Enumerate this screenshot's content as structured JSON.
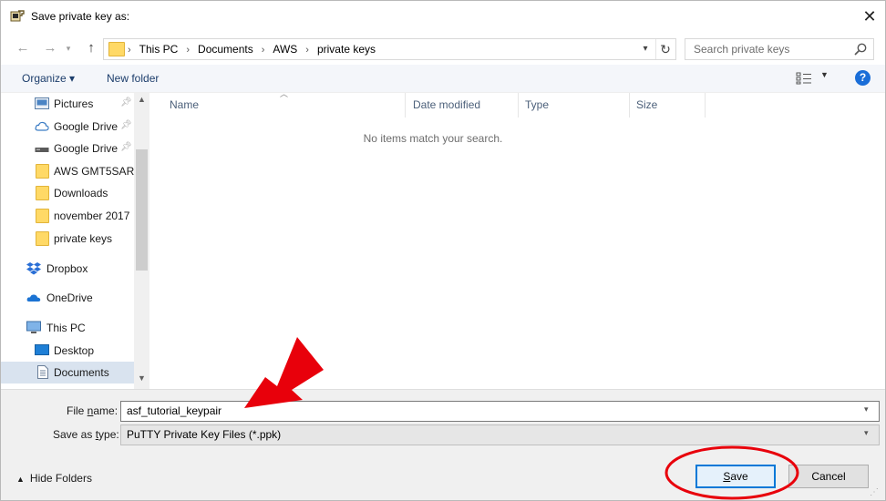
{
  "window": {
    "title": "Save private key as:",
    "close_glyph": "✕"
  },
  "nav": {
    "back_icon": "arrow-left-icon",
    "forward_icon": "arrow-right-icon",
    "recent_icon": "chevron-down-icon",
    "up_icon": "arrow-up-icon",
    "breadcrumb": [
      "This PC",
      "Documents",
      "AWS",
      "private keys"
    ],
    "search_placeholder": "Search private keys"
  },
  "toolbar": {
    "organize": "Organize ▾",
    "new_folder": "New folder",
    "help": "?"
  },
  "navpane": {
    "items": [
      {
        "label": "Pictures",
        "icon": "pictures-icon",
        "pinned": true
      },
      {
        "label": "Google Drive",
        "icon": "google-drive-icon",
        "pinned": true
      },
      {
        "label": "Google Drive",
        "icon": "drive-icon",
        "pinned": true
      },
      {
        "label": "AWS GMT5SAR",
        "icon": "folder-icon",
        "pinned": false
      },
      {
        "label": "Downloads",
        "icon": "folder-icon",
        "pinned": false
      },
      {
        "label": "november 2017",
        "icon": "folder-icon",
        "pinned": false
      },
      {
        "label": "private keys",
        "icon": "folder-icon",
        "pinned": false
      },
      {
        "label": "Dropbox",
        "icon": "dropbox-icon",
        "pinned": false
      },
      {
        "label": "OneDrive",
        "icon": "onedrive-icon",
        "pinned": false
      },
      {
        "label": "This PC",
        "icon": "computer-icon",
        "pinned": false
      },
      {
        "label": "Desktop",
        "icon": "desktop-icon",
        "pinned": false
      },
      {
        "label": "Documents",
        "icon": "documents-icon",
        "pinned": false,
        "selected": true
      }
    ]
  },
  "content": {
    "columns": [
      "Name",
      "Date modified",
      "Type",
      "Size"
    ],
    "empty_message": "No items match your search."
  },
  "bottom": {
    "file_name_label_pre": "File ",
    "file_name_label_ul": "n",
    "file_name_label_post": "ame:",
    "file_name_value": "asf_tutorial_keypair",
    "save_type_label_pre": "Save as ",
    "save_type_label_ul": "t",
    "save_type_label_post": "ype:",
    "save_type_value": "PuTTY Private Key Files (*.ppk)",
    "hide_folders": "Hide Folders",
    "save_ul": "S",
    "save_rest": "ave",
    "cancel": "Cancel"
  },
  "colors": {
    "annotation_red": "#e8000b",
    "accent_blue": "#0078d7",
    "folder_yellow": "#ffd966"
  }
}
